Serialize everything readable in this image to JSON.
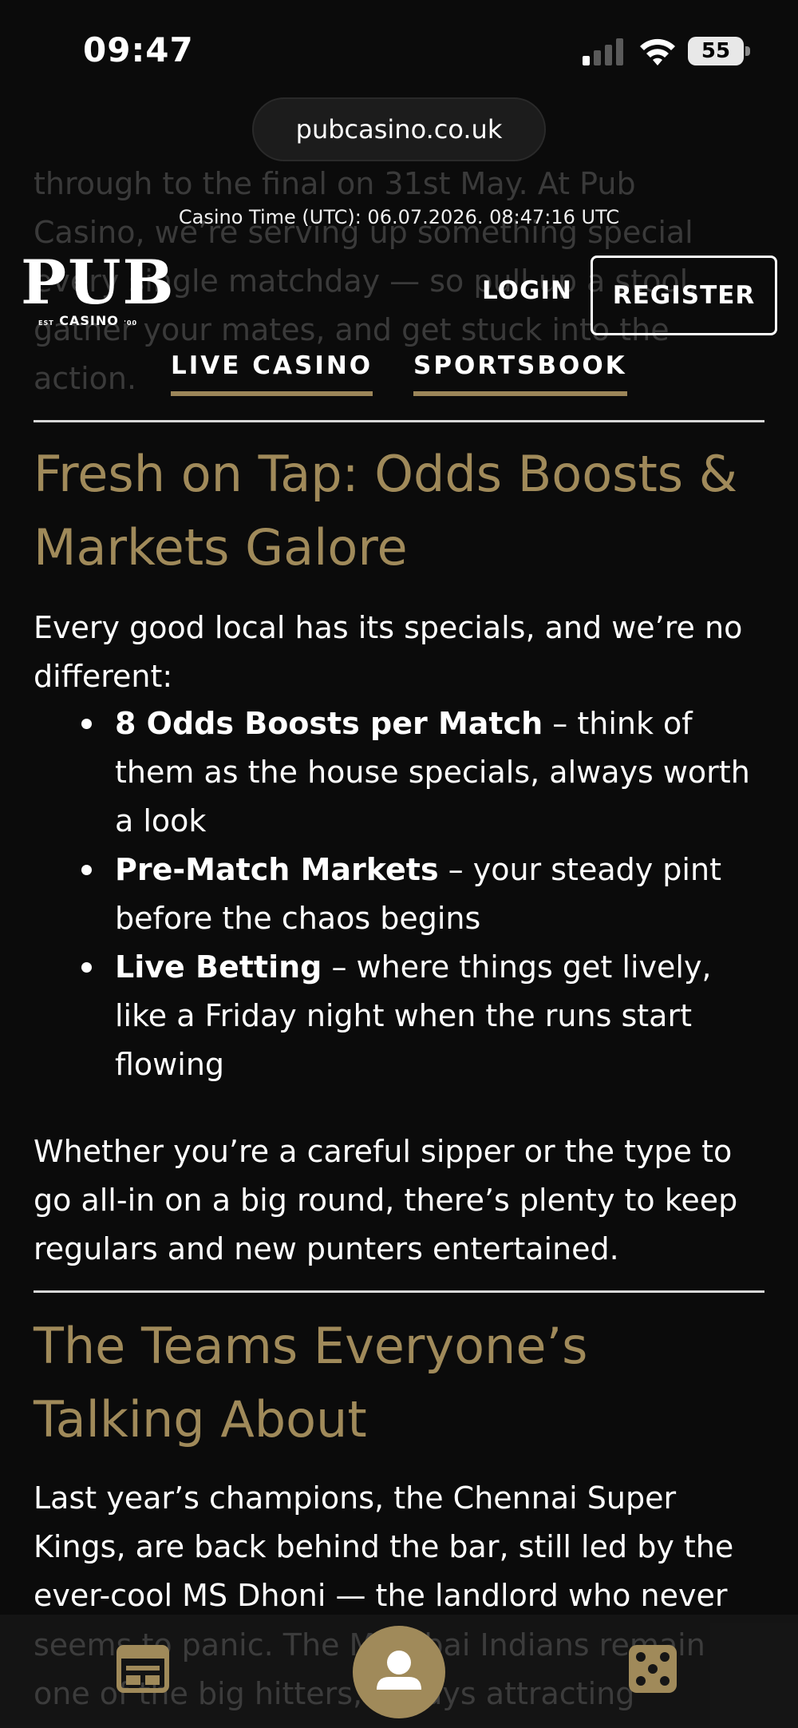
{
  "status_bar": {
    "time": "09:47",
    "battery": "55"
  },
  "browser": {
    "url": "pubcasino.co.uk"
  },
  "background_text": {
    "lines": [
      "through to the final on 31st May. At Pub",
      "Casino, we’re serving up something special",
      "every single matchday — so pull up a stool,",
      "gather your mates, and get stuck into the",
      "action."
    ]
  },
  "header": {
    "casino_time_label": "Casino Time (UTC): 06.07.2026. 08:47:16 UTC",
    "logo_word": "PUB",
    "logo_sub": "CASINO",
    "logo_est": "EST",
    "logo_year": "'00",
    "login_label": "LOGIN",
    "register_label": "REGISTER",
    "tabs": [
      {
        "label": "LIVE CASINO"
      },
      {
        "label": "SPORTSBOOK"
      }
    ]
  },
  "sections": [
    {
      "heading_line1": "Fresh on Tap: Odds Boosts &",
      "heading_line2": "Markets Galore",
      "intro": "Every good local has its specials, and we’re no different:",
      "bullets": [
        {
          "bold": "8 Odds Boosts per Match",
          "rest": " – think of them as the house specials, always worth a look"
        },
        {
          "bold": "Pre-Match Markets",
          "rest": " – your steady pint before the chaos begins"
        },
        {
          "bold": "Live Betting",
          "rest": " – where things get lively, like a Friday night when the runs start flowing"
        }
      ],
      "closing": "Whether you’re a careful sipper or the type to go all-in on a big round, there’s plenty to keep regulars and new punters entertained."
    },
    {
      "heading_line1": "The Teams Everyone’s",
      "heading_line2": "Talking About",
      "body": "Last year’s champions, the Chennai Super Kings, are back behind the bar, still led by the ever-cool MS Dhoni — the landlord who never"
    }
  ],
  "bottom_faded": {
    "line1": "seems to panic. The Mumbai Indians remain",
    "line2": "one of the big hitters, always attracting"
  },
  "bottom_nav": {
    "items": [
      {
        "icon": "calendar-icon"
      },
      {
        "icon": "profile-icon"
      },
      {
        "icon": "dice-icon"
      }
    ]
  },
  "colors": {
    "gold": "#a08a5a",
    "background": "#0b0b0b"
  }
}
